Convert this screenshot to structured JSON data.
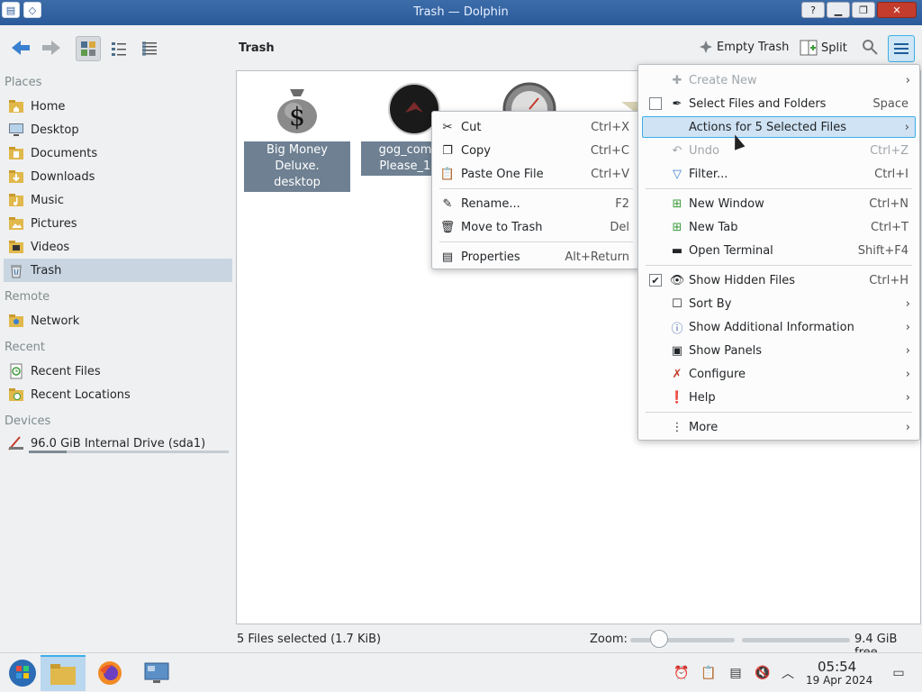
{
  "window": {
    "title": "Trash — Dolphin",
    "help_glyph": "?",
    "minimize_glyph": "▁",
    "maximize_glyph": "❐",
    "close_glyph": "✕"
  },
  "toolbar": {
    "breadcrumb": "Trash",
    "empty_trash_label": "Empty Trash",
    "split_label": "Split"
  },
  "sidebar": {
    "places_header": "Places",
    "places": [
      "Home",
      "Desktop",
      "Documents",
      "Downloads",
      "Music",
      "Pictures",
      "Videos",
      "Trash"
    ],
    "remote_header": "Remote",
    "remote": [
      "Network"
    ],
    "recent_header": "Recent",
    "recent": [
      "Recent Files",
      "Recent Locations"
    ],
    "devices_header": "Devices",
    "devices": [
      "96.0 GiB Internal Drive (sda1)"
    ],
    "drive_usage_fraction": 0.19
  },
  "files": [
    {
      "line1": "Big Money Deluxe.",
      "line2": "desktop"
    },
    {
      "line1": "gog_com-Pa",
      "line2": "Please_1.de"
    }
  ],
  "context_menu": {
    "items": [
      {
        "label": "Cut",
        "shortcut": "Ctrl+X"
      },
      {
        "label": "Copy",
        "shortcut": "Ctrl+C"
      },
      {
        "label": "Paste One File",
        "shortcut": "Ctrl+V"
      },
      {
        "label": "Rename...",
        "shortcut": "F2"
      },
      {
        "label": "Move to Trash",
        "shortcut": "Del"
      },
      {
        "label": "Properties",
        "shortcut": "Alt+Return"
      }
    ]
  },
  "main_menu": {
    "items": [
      {
        "label": "Create New",
        "shortcut": ""
      },
      {
        "label": "Select Files and Folders",
        "shortcut": "Space"
      },
      {
        "label": "Actions for 5 Selected Files",
        "shortcut": ""
      },
      {
        "label": "Undo",
        "shortcut": "Ctrl+Z"
      },
      {
        "label": "Filter...",
        "shortcut": "Ctrl+I"
      },
      {
        "label": "New Window",
        "shortcut": "Ctrl+N"
      },
      {
        "label": "New Tab",
        "shortcut": "Ctrl+T"
      },
      {
        "label": "Open Terminal",
        "shortcut": "Shift+F4"
      },
      {
        "label": "Show Hidden Files",
        "shortcut": "Ctrl+H"
      },
      {
        "label": "Sort By",
        "shortcut": ""
      },
      {
        "label": "Show Additional Information",
        "shortcut": ""
      },
      {
        "label": "Show Panels",
        "shortcut": ""
      },
      {
        "label": "Configure",
        "shortcut": ""
      },
      {
        "label": "Help",
        "shortcut": ""
      },
      {
        "label": "More",
        "shortcut": ""
      }
    ]
  },
  "statusbar": {
    "selection": "5 Files selected (1.7 KiB)",
    "zoom_label": "Zoom:",
    "free_space": "9.4 GiB free"
  },
  "taskbar": {
    "time": "05:54",
    "date": "19 Apr 2024"
  },
  "colors": {
    "accent": "#3daee9",
    "selection": "#6e8092",
    "titlebar": "#2a5a9a"
  }
}
